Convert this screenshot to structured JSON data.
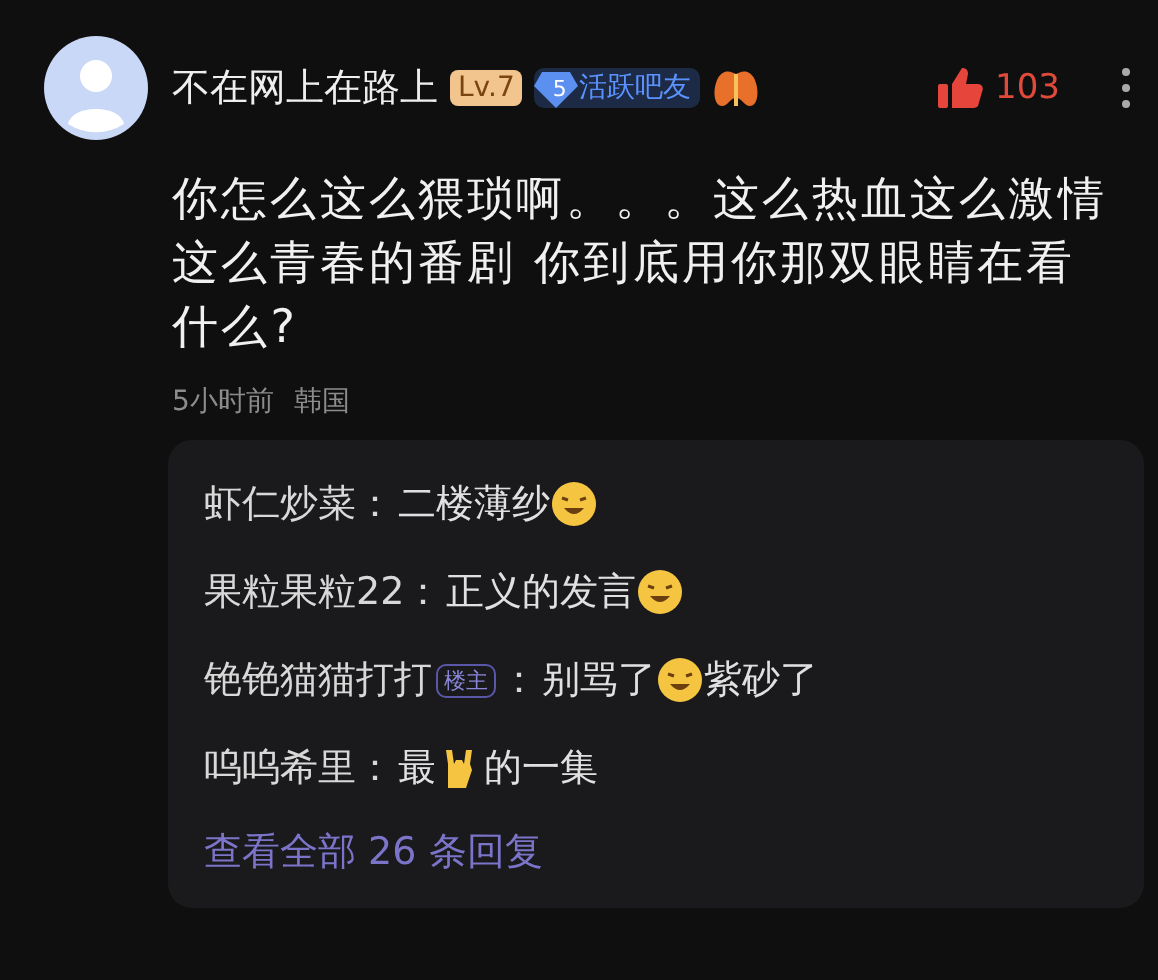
{
  "comment": {
    "author": "不在网上在路上",
    "level_badge": "Lv.7",
    "fan_badge": {
      "number": "5",
      "label": "活跃吧友"
    },
    "likes": "103",
    "text": "你怎么这么猥琐啊。。。这么热血这么激情这么青春的番剧 你到底用你那双眼睛在看什么?",
    "time": "5小时前",
    "location": "韩国"
  },
  "replies": [
    {
      "author": "虾仁炒菜",
      "separator": "：",
      "parts": [
        {
          "kind": "text",
          "text": "二楼薄纱"
        },
        {
          "kind": "face"
        }
      ]
    },
    {
      "author": "果粒果粒22",
      "separator": "：",
      "parts": [
        {
          "kind": "text",
          "text": "正义的发言"
        },
        {
          "kind": "face"
        }
      ]
    },
    {
      "author": "铯铯猫猫打打",
      "op_badge": "楼主",
      "separator": "：",
      "parts": [
        {
          "kind": "text",
          "text": "别骂了"
        },
        {
          "kind": "face"
        },
        {
          "kind": "text",
          "text": "紫砂了"
        }
      ]
    },
    {
      "author": "呜呜希里",
      "separator": "：",
      "parts": [
        {
          "kind": "text",
          "text": "最"
        },
        {
          "kind": "hand"
        },
        {
          "kind": "text",
          "text": "的一集"
        }
      ]
    }
  ],
  "view_all": "查看全部 26 条回复"
}
